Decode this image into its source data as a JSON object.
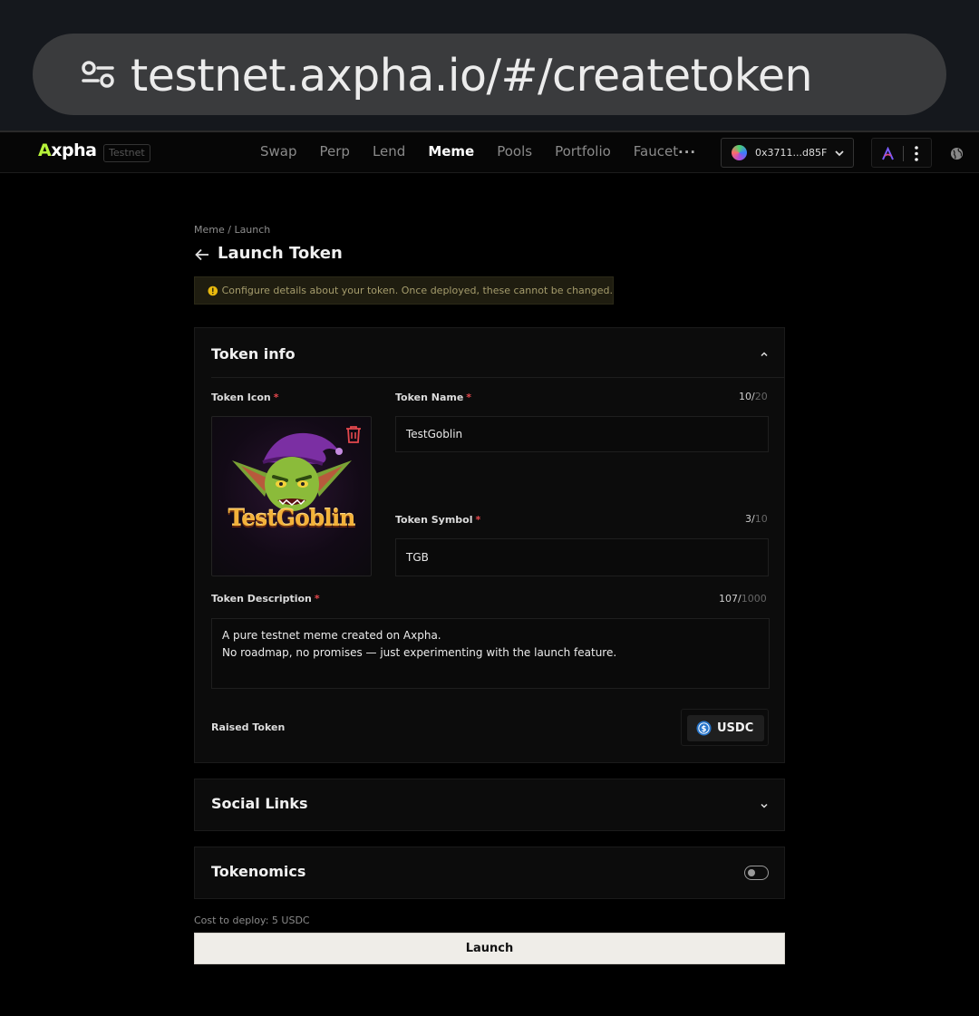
{
  "browser": {
    "url": "testnet.axpha.io/#/createtoken"
  },
  "nav": {
    "logo_a": "A",
    "logo_rest": "xpha",
    "env_badge": "Testnet",
    "links": [
      "Swap",
      "Perp",
      "Lend",
      "Meme",
      "Pools",
      "Portfolio",
      "Faucet"
    ],
    "active_link": "Meme",
    "more": "...",
    "wallet_address": "0x3711...d85F"
  },
  "page": {
    "breadcrumb": "Meme / Launch",
    "title": "Launch Token",
    "notice": "Configure details about your token. Once deployed, these cannot be changed."
  },
  "token_info": {
    "title": "Token info",
    "icon_label": "Token Icon",
    "icon_image_text": "TestGoblin",
    "name_label": "Token Name",
    "name_value": "TestGoblin",
    "name_count": "10",
    "name_max": "20",
    "symbol_label": "Token Symbol",
    "symbol_value": "TGB",
    "symbol_count": "3",
    "symbol_max": "10",
    "description_label": "Token Description",
    "description_line1": "A pure testnet meme created on Axpha.",
    "description_line2": "No roadmap, no promises — just experimenting with the launch feature.",
    "description_count": "107",
    "description_max": "1000",
    "raised_label": "Raised Token",
    "raised_token": "USDC",
    "required_mark": "*"
  },
  "social_links": {
    "title": "Social Links"
  },
  "tokenomics": {
    "title": "Tokenomics",
    "enabled": false
  },
  "footer": {
    "cost": "Cost to deploy: 5 USDC",
    "launch_label": "Launch"
  },
  "colors": {
    "accent_logo": "#b6f23a",
    "required": "#e5484d",
    "notice_text": "#a59c6c",
    "launch_bg": "#efede8",
    "usdc": "#2775ca"
  }
}
